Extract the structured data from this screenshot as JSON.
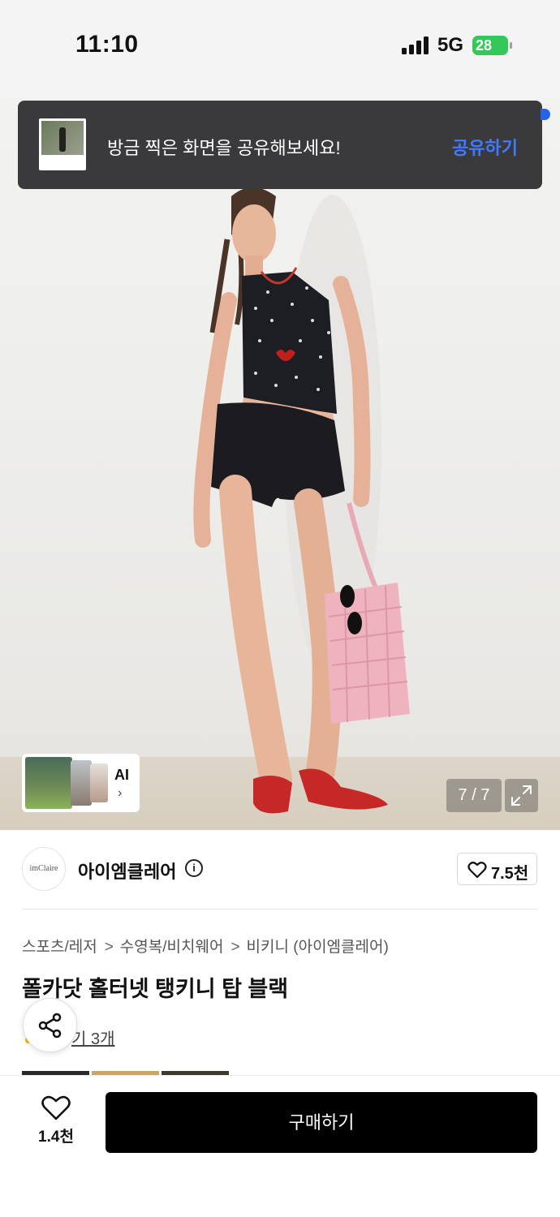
{
  "status_bar": {
    "time": "11:10",
    "network": "5G",
    "battery": "28"
  },
  "toast": {
    "message": "방금 찍은 화면을 공유해보세요!",
    "action": "공유하기"
  },
  "gallery": {
    "ai_label": "AI",
    "counter": "7 / 7"
  },
  "brand": {
    "logo_text": "imClaire",
    "name": "아이엠클레어",
    "likes": "7.5천"
  },
  "breadcrumb": [
    "스포츠/레저",
    "수영복/비치웨어",
    "비키니 (아이엠클레어)"
  ],
  "product": {
    "title": "폴카닷 홀터넷 탱키니 탑 블랙",
    "reviews": "후기 3개",
    "reviews_visible": "기 3개"
  },
  "bottom_bar": {
    "wish_count": "1.4천",
    "buy_label": "구매하기"
  },
  "colors": {
    "toast_bg": "#3a3a3c",
    "toast_action": "#3f7bff",
    "battery": "#34c759",
    "buy_button": "#000000"
  }
}
